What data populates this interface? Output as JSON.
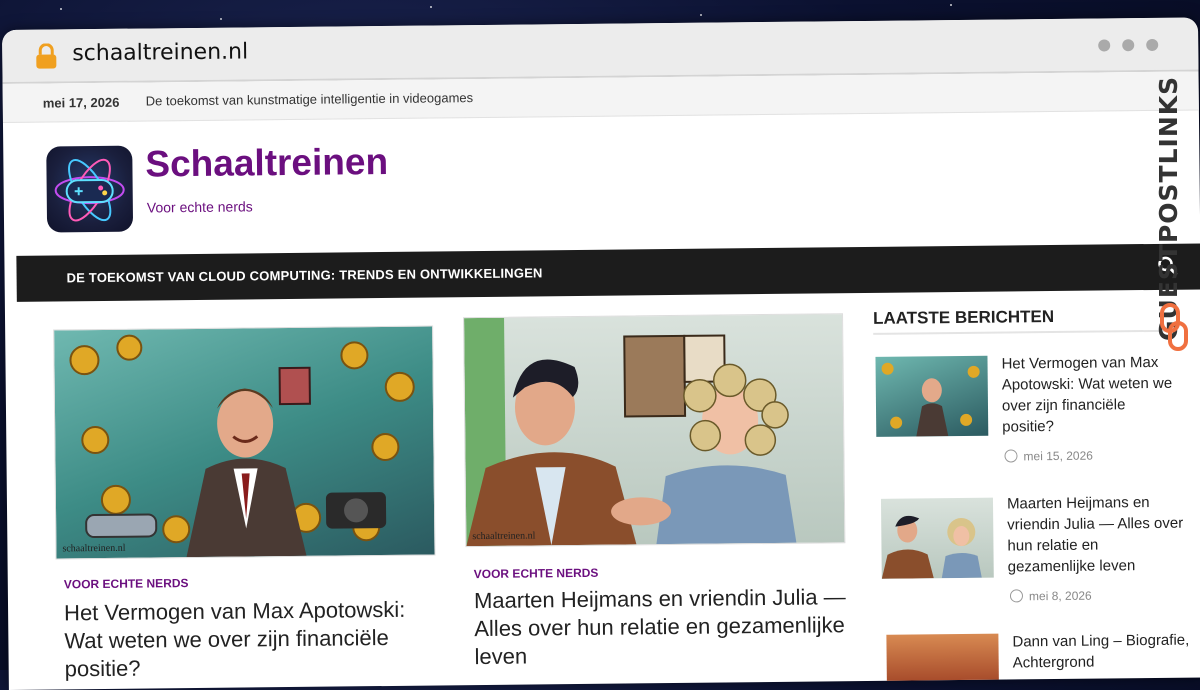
{
  "browser": {
    "url": "schaaltreinen.nl"
  },
  "topbar": {
    "date": "mei 17, 2026",
    "ticker": "De toekomst van kunstmatige intelligentie in videogames"
  },
  "site": {
    "title": "Schaaltreinen",
    "tagline": "Voor echte nerds"
  },
  "nav": {
    "item": "DE TOEKOMST VAN CLOUD COMPUTING: TRENDS EN ONTWIKKELINGEN",
    "search_icon": "search-icon"
  },
  "posts": [
    {
      "category": "VOOR ECHTE NERDS",
      "title": "Het Vermogen van Max Apotowski: Wat weten we over zijn financiële positie?",
      "watermark": "schaaltreinen.nl"
    },
    {
      "category": "VOOR ECHTE NERDS",
      "title": "Maarten Heijmans en vriendin Julia — Alles over hun relatie en gezamenlijke leven",
      "watermark": "schaaltreinen.nl"
    }
  ],
  "sidebar": {
    "heading": "LAATSTE BERICHTEN",
    "items": [
      {
        "title": "Het Vermogen van Max Apotowski: Wat weten we over zijn financiële positie?",
        "date": "mei 15, 2026"
      },
      {
        "title": "Maarten Heijmans en vriendin Julia — Alles over hun relatie en gezamenlijke leven",
        "date": "mei 8, 2026"
      },
      {
        "title": "Dann van Ling – Biografie, Achtergrond",
        "date": ""
      }
    ]
  },
  "overlay": {
    "brand": "GUESTPOSTLINKS"
  },
  "colors": {
    "accent": "#6b0f7f",
    "nav_bg": "#1c1c1c",
    "lock": "#f0a020"
  }
}
